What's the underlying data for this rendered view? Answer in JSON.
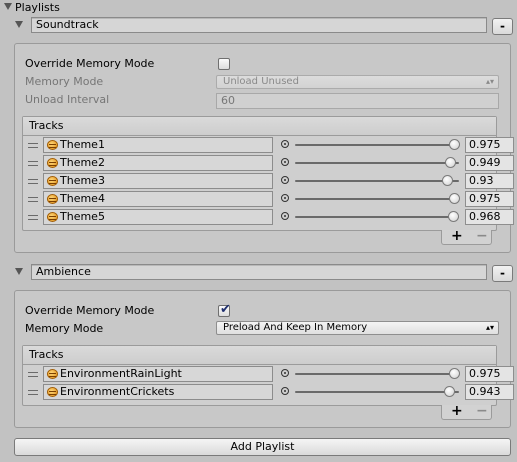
{
  "header": {
    "title": "Playlists"
  },
  "playlists": [
    {
      "name": "Soundtrack",
      "remove_label": "-",
      "override_label": "Override Memory Mode",
      "override_checked": false,
      "memory_mode_label": "Memory Mode",
      "memory_mode_value": "Unload Unused",
      "unload_interval_label": "Unload Interval",
      "unload_interval_value": "60",
      "tracks_label": "Tracks",
      "tracks": [
        {
          "name": "Theme1",
          "volume": 0.975,
          "volume_text": "0.975"
        },
        {
          "name": "Theme2",
          "volume": 0.949,
          "volume_text": "0.949"
        },
        {
          "name": "Theme3",
          "volume": 0.93,
          "volume_text": "0.93"
        },
        {
          "name": "Theme4",
          "volume": 0.975,
          "volume_text": "0.975"
        },
        {
          "name": "Theme5",
          "volume": 0.968,
          "volume_text": "0.968"
        }
      ],
      "add_label": "+",
      "remove_track_label": "−"
    },
    {
      "name": "Ambience",
      "remove_label": "-",
      "override_label": "Override Memory Mode",
      "override_checked": true,
      "memory_mode_label": "Memory Mode",
      "memory_mode_value": "Preload And Keep In Memory",
      "tracks_label": "Tracks",
      "tracks": [
        {
          "name": "EnvironmentRainLight",
          "volume": 0.975,
          "volume_text": "0.975"
        },
        {
          "name": "EnvironmentCrickets",
          "volume": 0.943,
          "volume_text": "0.943"
        }
      ],
      "add_label": "+",
      "remove_track_label": "−"
    }
  ],
  "add_playlist_label": "Add Playlist",
  "icons": {
    "foldout": "triangle-down-icon",
    "dropdown": "dropdown-arrow-icon",
    "drag": "drag-handle-icon",
    "audio": "audio-clip-icon",
    "speaker": "speaker-icon"
  }
}
